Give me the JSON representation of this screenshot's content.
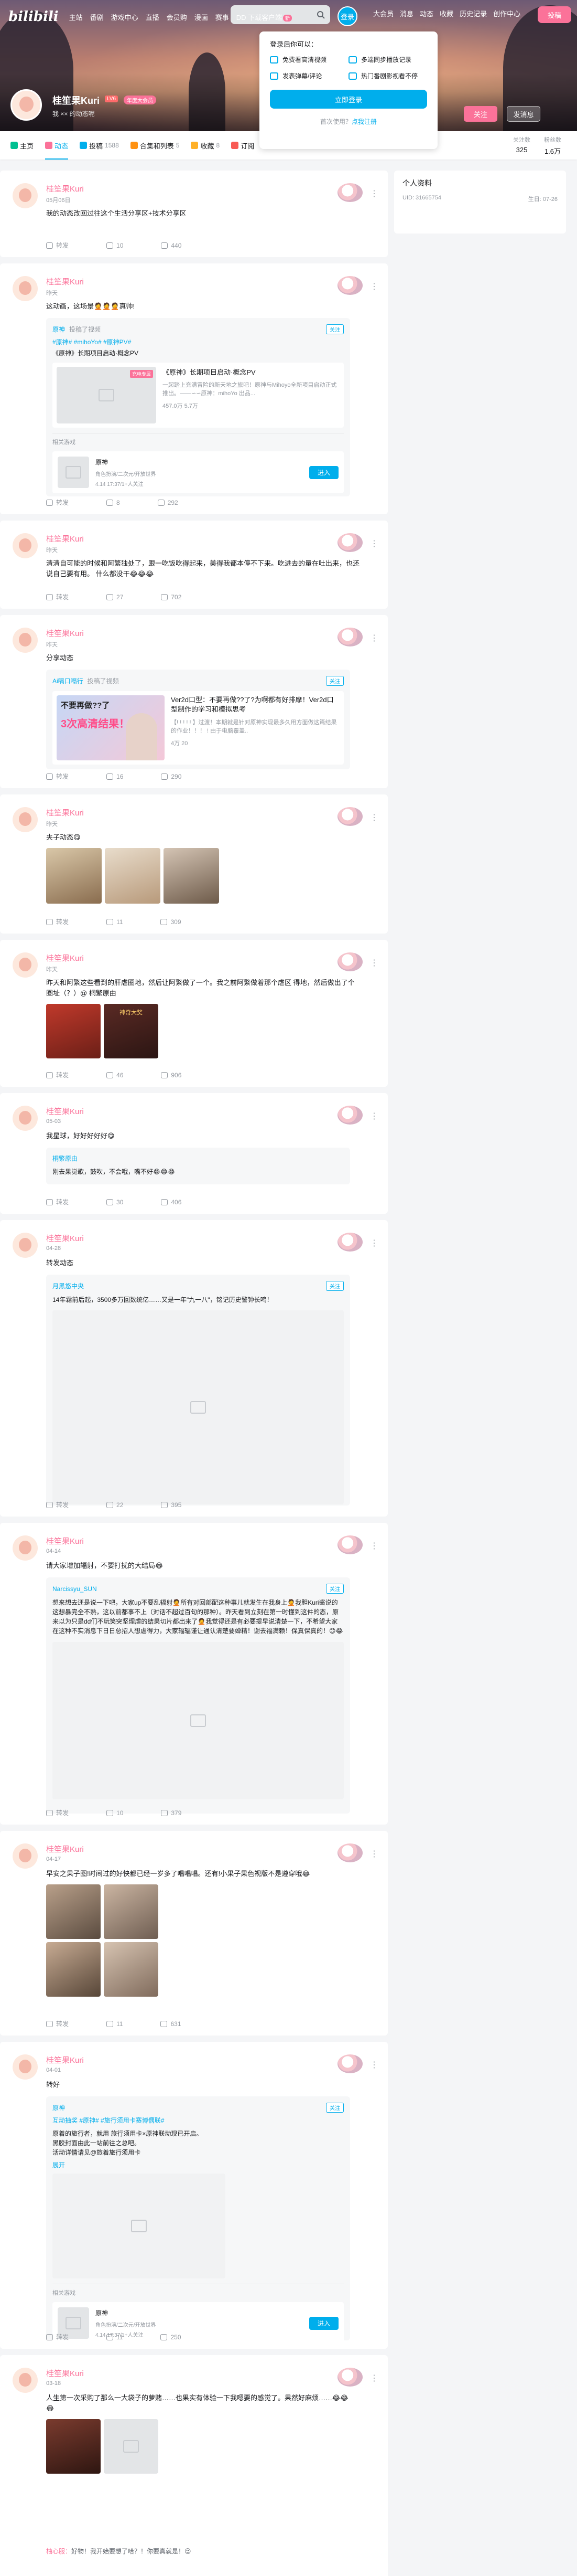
{
  "header": {
    "logo": "bilibili",
    "nav": [
      "主站",
      "番剧",
      "游戏中心",
      "直播",
      "会员购",
      "漫画",
      "赛事",
      "DD 下载客户端"
    ],
    "nav_badge": "新",
    "login": "登录",
    "right_nav": [
      "大会员",
      "消息",
      "动态",
      "收藏",
      "历史记录",
      "创作中心"
    ],
    "upload": "投稿"
  },
  "login_popover": {
    "title": "登录后你可以：",
    "features": [
      "免费看高清视频",
      "多端同步播放记录",
      "发表弹幕/评论",
      "热门番剧影视看不停"
    ],
    "button": "立即登录",
    "register_prefix": "首次使用？",
    "register_link": "点我注册"
  },
  "profile": {
    "name": "桂笙果Kuri",
    "level": "LV6",
    "vip": "年度大会员",
    "sign": "我 ×× 的动态呢",
    "follow": "关注",
    "message": "发消息"
  },
  "tabs": [
    {
      "label": "主页",
      "count": ""
    },
    {
      "label": "动态",
      "count": ""
    },
    {
      "label": "投稿",
      "count": "1588"
    },
    {
      "label": "合集和列表",
      "count": "5"
    },
    {
      "label": "收藏",
      "count": "8"
    },
    {
      "label": "订阅",
      "count": ""
    }
  ],
  "stats": [
    {
      "label": "关注数",
      "value": "325"
    },
    {
      "label": "粉丝数",
      "value": "1.6万"
    }
  ],
  "side": {
    "title": "个人资料",
    "uid_label": "UID: 31665754",
    "birthday": "生日: 07-26"
  },
  "posts": [
    {
      "name": "桂笙果Kuri",
      "time": "05月06日",
      "text": "我的动态改回过往这个生活分享区+技术分享区",
      "share": "转发",
      "comment": "10",
      "like": "440"
    },
    {
      "name": "桂笙果Kuri",
      "time": "昨天",
      "text": "这动画，这场景🤦🤦🤦真帅!",
      "share": "转发",
      "comment": "8",
      "like": "292",
      "inner": {
        "up": "原神",
        "sub": "投稿了视频",
        "follow": "关注",
        "tags": "#原神# #mihoYo# #原神PV#",
        "title": "《原神》长期项目启动·概念PV",
        "video_title": "《原神》长期项目启动·概念PV",
        "video_desc": "一起踏上充满冒险的新天地之旅吧！原神与Mihoyo全新项目启动正式推出。——∽∽原神：mihoYo 出品...",
        "video_badge": "充电专属",
        "video_stats": "457.0万  5.7万",
        "game_label": "相关游戏",
        "game_name": "原神",
        "game_desc": "角色扮演/二次元/开放世界",
        "game_date": "4.14 17:37/1+人关注",
        "game_btn": "进入"
      }
    },
    {
      "name": "桂笙果Kuri",
      "time": "昨天",
      "text": "清清自可能的时候和阿繁独处了，跟一吃饭吃得起来，美得我都本停不下来。吃进去的量在吐出来，也还说自己要有用。 什么都没干😂😂😂",
      "share": "转发",
      "comment": "27",
      "like": "702"
    },
    {
      "name": "桂笙果Kuri",
      "time": "昨天",
      "text": "分享动态",
      "share": "转发",
      "comment": "16",
      "like": "290",
      "inner": {
        "up": "Ai嗝口嗝行",
        "sub": "投稿了视频",
        "follow": "关注",
        "video_title": "Ver2d口型：不要再做??了?为啊都有好排摩！Ver2d口型制作的学习和模拟思考",
        "video_desc": "【! ! ! ! ! 】过渡！本期就是针对原神实现最多久用方面做这篇结果的作业！！！ ! 由于电脑覆盖..",
        "img_caption": "不要再做??了",
        "img_caption2": "3次高清结果！",
        "video_stats": "4万  20"
      }
    },
    {
      "name": "桂笙果Kuri",
      "time": "昨天",
      "text": "夹子动态😋",
      "share": "转发",
      "comment": "11",
      "like": "309"
    },
    {
      "name": "桂笙果Kuri",
      "time": "昨天",
      "text": "昨天和阿繁这些看到的肝虐圈地，然后让阿繁做了一个。我之前阿繁做着那个虐区 得地，然后做出了个圈址（？）@ 桐繁原由",
      "share": "转发",
      "comment": "46",
      "like": "906",
      "pic_text": "神奇大奖"
    },
    {
      "name": "桂笙果Kuri",
      "time": "05-03",
      "text": "我星球，好好好好好😋",
      "share": "转发",
      "comment": "30",
      "like": "406",
      "inner": {
        "up": "桐繁原由",
        "text": "刚去果觉歌，鼓吹，不会哦，嘴不好😂😂😂"
      }
    },
    {
      "name": "桂笙果Kuri",
      "time": "04-28",
      "text": "转发动态",
      "share": "转发",
      "comment": "22",
      "like": "395",
      "inner": {
        "up": "月黑悠中央",
        "follow": "关注",
        "text": "14年霜前后起，3500多万回数统亿……又是一年\"九一八\"，铭记历史警钟长鸣！"
      }
    },
    {
      "name": "桂笙果Kuri",
      "time": "04-14",
      "text": "请大家增加辐射，不要打扰的大结局😂",
      "share": "转发",
      "comment": "10",
      "like": "379",
      "inner": {
        "up": "Narcissyu_SUN",
        "follow": "关注",
        "text": "想来想去还是说一下吧，大家up不要乱辐射🤦所有对回部配这种事儿就发生在我身上🤦我胆Kuri酱说的这想暴完全不熟，这以前都事不上（对话不超过百句的那种）。昨天看到立刻在第一时懂到这件的态，原来以为只是dd们不玩笑突坚理虐的结果切片都出来了🤦我觉得还是有必要提早说清楚一下，不希望大家在这种不实消息下日日总招人想虐得力，大家辐辐谨让通认清楚要蝉精！谢去福满赖！保真保真的！😊😂"
      }
    },
    {
      "name": "桂笙果Kuri",
      "time": "04-17",
      "text": "早安之果子图!时间过的好快都已经一岁多了唱唱唱。还有!小果子果色视版不是遵穿哦😂",
      "share": "转发",
      "comment": "11",
      "like": "631"
    },
    {
      "name": "桂笙果Kuri",
      "time": "04-01",
      "text": "转好",
      "share": "转发",
      "comment": "11",
      "like": "250",
      "inner": {
        "up": "原神",
        "follow": "关注",
        "tags": "互动抽奖 #原神# #旅行须用卡赛博偶联#",
        "text": "原着的旅行者，就用 旅行须用卡×原神联动现已开启。\n黑胶封面由此一站前往之总吧。\n活动详情请见@旅着旅行须用卡",
        "expand": "展开",
        "game_label": "相关游戏",
        "game_name": "原神",
        "game_desc": "角色扮演/二次元/开放世界",
        "game_date": "4.14 17:37/1+人关注",
        "game_btn": "进入"
      }
    },
    {
      "name": "桂笙果Kuri",
      "time": "03-18",
      "text": "人生第一次采购了那么一大袋子的萝赌……也果实有体验一下我嗯要的感觉了。果然好麻烦……😂😂😂",
      "comment_line_name": "柚心服：",
      "comment_line": "好物！我开始要想了哈？！你要真就是！😍"
    }
  ]
}
